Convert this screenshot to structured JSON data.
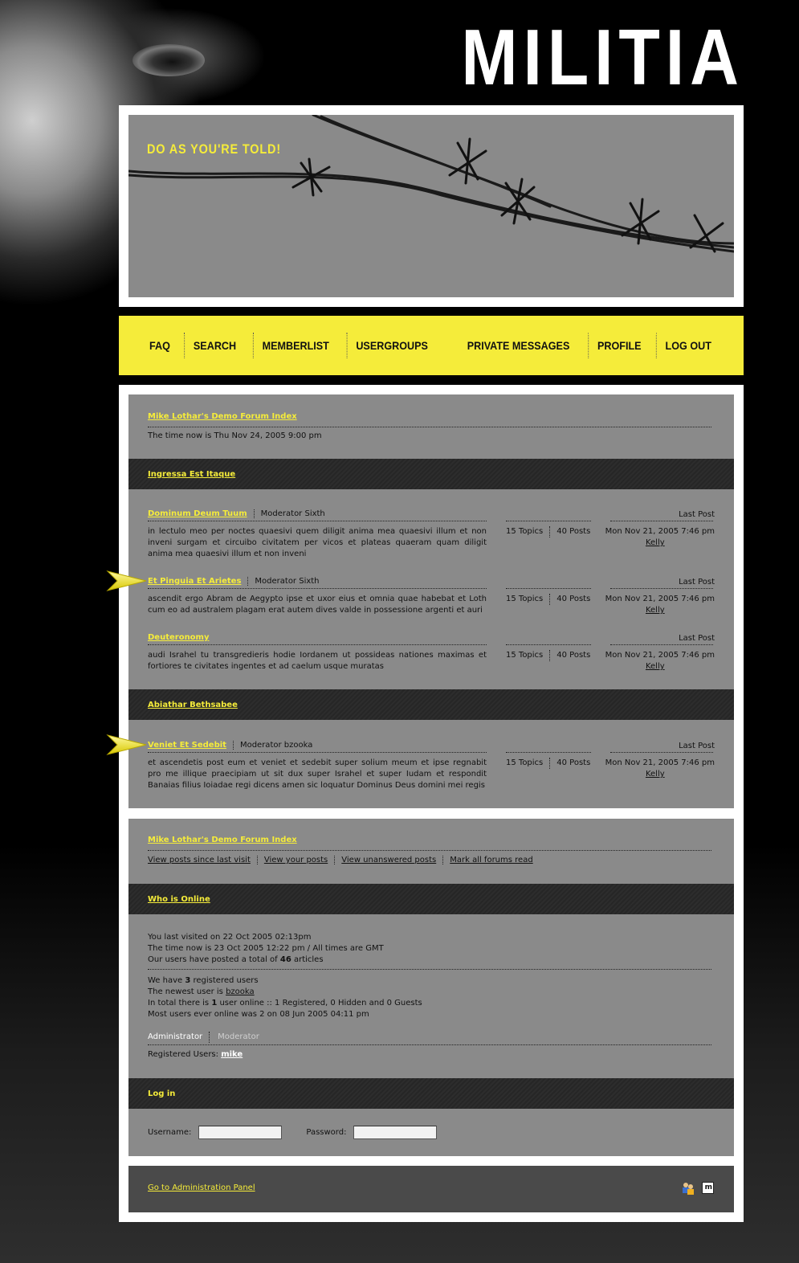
{
  "brand": {
    "title": "MILITIA"
  },
  "banner": {
    "slogan": "DO AS YOU'RE TOLD!"
  },
  "nav": {
    "left": [
      "FAQ",
      "SEARCH",
      "MEMBERLIST",
      "USERGROUPS"
    ],
    "right": [
      "PRIVATE MESSAGES",
      "PROFILE",
      "LOG OUT"
    ]
  },
  "index": {
    "title": "Mike Lothar's Demo Forum Index",
    "time_now": "The time now is Thu Nov 24, 2005 9:00 pm"
  },
  "categories": [
    {
      "title": "Ingressa Est Itaque",
      "forums": [
        {
          "name": "Dominum Deum Tuum",
          "moderator": "Moderator Sixth",
          "description": "in lectulo meo per noctes quaesivi quem diligit anima mea quaesivi illum et non inveni surgam et circuibo civitatem per vicos et plateas quaeram quam diligit anima mea quaesivi illum et non inveni",
          "topics": "15 Topics",
          "posts": "40 Posts",
          "last_label": "Last Post",
          "last_date": "Mon Nov 21, 2005 7:46 pm",
          "last_user": "Kelly",
          "new_posts": false
        },
        {
          "name": "Et Pinguia Et Arietes",
          "moderator": "Moderator Sixth",
          "description": "ascendit ergo Abram de Aegypto ipse et uxor eius et omnia quae habebat et Loth cum eo ad australem plagam erat autem dives valde in possessione argenti et auri",
          "topics": "15 Topics",
          "posts": "40 Posts",
          "last_label": "Last Post",
          "last_date": "Mon Nov 21, 2005 7:46 pm",
          "last_user": "Kelly",
          "new_posts": true
        },
        {
          "name": "Deuteronomy",
          "moderator": "",
          "description": "audi Israhel tu transgredieris hodie Iordanem ut possideas nationes maximas et fortiores te civitates ingentes et ad caelum usque muratas",
          "topics": "15 Topics",
          "posts": "40 Posts",
          "last_label": "Last Post",
          "last_date": "Mon Nov 21, 2005 7:46 pm",
          "last_user": "Kelly",
          "new_posts": false
        }
      ]
    },
    {
      "title": "Abiathar Bethsabee",
      "forums": [
        {
          "name": "Veniet Et Sedebit",
          "moderator": "Moderator bzooka",
          "description": "et ascendetis post eum et veniet et sedebit super solium meum et ipse regnabit pro me illique praecipiam ut sit dux super Israhel et super Iudam et respondit Banaias filius Ioiadae regi dicens amen sic loquatur Dominus Deus domini mei regis",
          "topics": "15 Topics",
          "posts": "40 Posts",
          "last_label": "Last Post",
          "last_date": "Mon Nov 21, 2005 7:46 pm",
          "last_user": "Kelly",
          "new_posts": true
        }
      ]
    }
  ],
  "footer_index": {
    "title": "Mike Lothar's Demo Forum Index",
    "links": [
      "View posts since last visit",
      "View your posts",
      "View unanswered posts",
      "Mark all forums read"
    ]
  },
  "who_online": {
    "title": "Who is Online",
    "last_visited": "You last visited on 22 Oct 2005 02:13pm",
    "time_now": "The time now is 23 Oct 2005 12:22 pm / All times are GMT",
    "articles_pre": "Our users have posted a total of ",
    "articles_count": "46",
    "articles_post": " articles",
    "registered_pre": "We have ",
    "registered_count": "3",
    "registered_post": " registered users",
    "newest_pre": "The newest user is ",
    "newest_user": "bzooka",
    "total_pre": "In total there is ",
    "total_count": "1",
    "total_post": " user online :: 1 Registered, 0 Hidden and 0 Guests",
    "most_ever": "Most users ever online was 2 on 08 Jun 2005 04:11 pm",
    "legend_admin": "Administrator",
    "legend_mod": "Moderator",
    "registered_users_label": "Registered Users: ",
    "registered_users_name": "mike"
  },
  "login": {
    "title": "Log in",
    "username_label": "Username:",
    "password_label": "Password:"
  },
  "admin": {
    "link": "Go to Administration Panel"
  },
  "colors": {
    "accent": "#f5ec3a",
    "panel": "#8a8a8a",
    "dark_bar": "#2b2b2b"
  }
}
